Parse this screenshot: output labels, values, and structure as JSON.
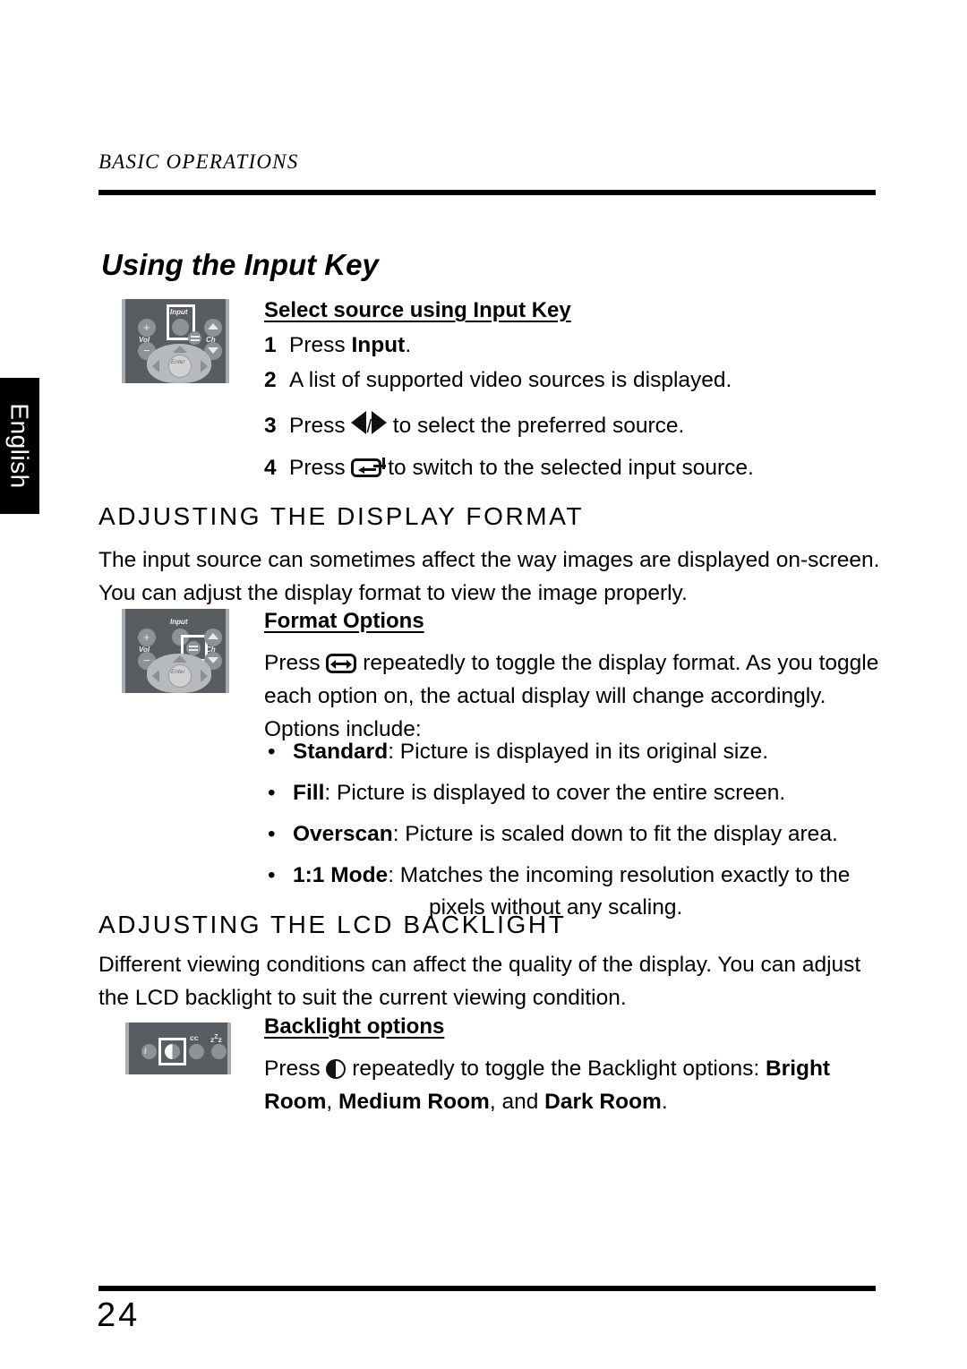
{
  "language_tab": {
    "label": "English"
  },
  "header": {
    "running_head": "BASIC OPERATIONS"
  },
  "footer": {
    "page_number": "24"
  },
  "title": "Using the Input Key",
  "input_key": {
    "subhead": "Select source using Input Key",
    "steps": [
      {
        "num": "1",
        "before": "Press ",
        "bold": "Input",
        "after": "."
      },
      {
        "num": "2",
        "text": "A list of supported video sources is displayed."
      },
      {
        "num": "3",
        "before": "Press ",
        "icon": "left-right-arrows-icon",
        "after": " to select the preferred source.",
        "separator": "/"
      },
      {
        "num": "4",
        "before": "Press ",
        "icon": "enter-key-icon",
        "after": " to switch to the selected input source."
      }
    ]
  },
  "display_format": {
    "heading": "ADJUSTING THE DISPLAY FORMAT",
    "intro": "The input source can sometimes affect the way images are displayed on-screen. You can adjust the display format to view the image properly.",
    "subhead": "Format Options",
    "body_before": "Press ",
    "body_icon": "display-format-icon",
    "body_after": " repeatedly to toggle the display format. As you toggle each option on, the actual display will change accordingly. Options include:",
    "bullets": [
      {
        "marker": "•",
        "term": "Standard",
        "desc": ": Picture is displayed in its original size."
      },
      {
        "marker": "•",
        "term": "Fill",
        "desc": ": Picture is displayed to cover the entire screen."
      },
      {
        "marker": "•",
        "term": "Overscan",
        "desc": ": Picture is scaled down to fit the display area."
      },
      {
        "marker": "•",
        "term": "1:1 Mode",
        "desc": ": Matches the incoming resolution exactly to the",
        "cont": "pixels without any scaling."
      }
    ]
  },
  "backlight": {
    "heading": "ADJUSTING THE LCD BACKLIGHT",
    "intro": "Different viewing conditions can affect the quality of the display. You can adjust the LCD backlight to suit the current viewing condition.",
    "subhead": "Backlight options",
    "body_before": "Press ",
    "body_icon": "backlight-contrast-icon",
    "body_mid": " repeatedly to toggle the Backlight options: ",
    "option_1": "Bright Room",
    "sep_1": ", ",
    "option_2": "Medium Room",
    "sep_2": ", and ",
    "option_3": "Dark Room",
    "end": "."
  },
  "remote_illustrations": {
    "input": {
      "name": "remote-with-input-highlighted",
      "labels": {
        "input": "Input",
        "vol": "Vol",
        "ch": "Ch",
        "enter": "Enter",
        "plus": "+",
        "minus": "−"
      },
      "highlighted_button": "Input"
    },
    "format": {
      "name": "remote-with-format-highlighted",
      "labels": {
        "input": "Input",
        "vol": "Vol",
        "ch": "Ch",
        "enter": "Enter",
        "plus": "+",
        "minus": "−"
      },
      "highlighted_button": "Display Format"
    },
    "backlight": {
      "name": "remote-strip-with-backlight-highlighted",
      "labels": {
        "info": "i",
        "cc": "cc",
        "sleep": "z",
        "sleep_sup": "Z",
        "sleep_end": "z"
      },
      "highlighted_button": "Backlight"
    }
  },
  "colors": {
    "remote_body": "#585d61",
    "remote_button": "#8e9295",
    "remote_edge": "#a9acae",
    "ink": "#000000"
  }
}
